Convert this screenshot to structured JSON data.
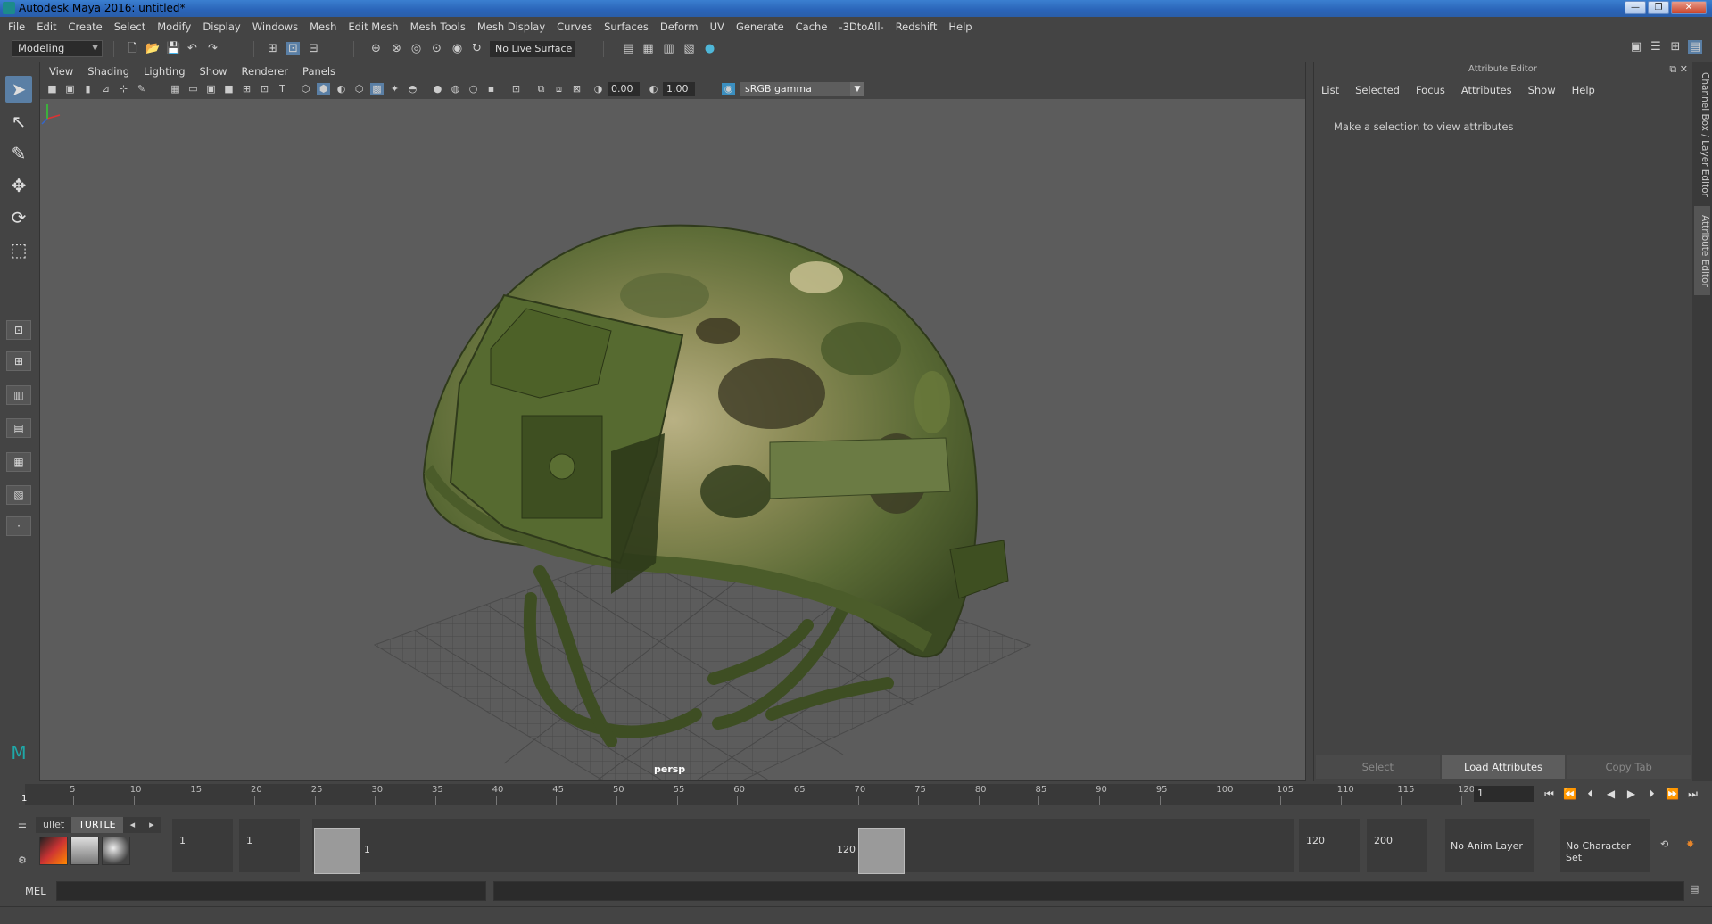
{
  "window": {
    "title": "Autodesk Maya 2016: untitled*",
    "controls": [
      "—",
      "❐",
      "✕"
    ]
  },
  "menubar": [
    "File",
    "Edit",
    "Create",
    "Select",
    "Modify",
    "Display",
    "Windows",
    "Mesh",
    "Edit Mesh",
    "Mesh Tools",
    "Mesh Display",
    "Curves",
    "Surfaces",
    "Deform",
    "UV",
    "Generate",
    "Cache",
    "-3DtoAll-",
    "Redshift",
    "Help"
  ],
  "toolbar": {
    "mode": "Modeling",
    "live_surface": "No Live Surface"
  },
  "panel": {
    "menu": [
      "View",
      "Shading",
      "Lighting",
      "Show",
      "Renderer",
      "Panels"
    ],
    "exposure": "0.00",
    "gamma": "1.00",
    "color_space": "sRGB gamma",
    "camera": "persp"
  },
  "attribute_editor": {
    "title": "Attribute Editor",
    "menu": [
      "List",
      "Selected",
      "Focus",
      "Attributes",
      "Show",
      "Help"
    ],
    "message": "Make a selection to view attributes",
    "buttons": {
      "select": "Select",
      "load": "Load Attributes",
      "copy": "Copy Tab"
    }
  },
  "side_tabs": {
    "channel_box": "Channel Box / Layer Editor",
    "attribute_editor": "Attribute Editor"
  },
  "timeslider": {
    "ticks": [
      "5",
      "10",
      "15",
      "20",
      "25",
      "30",
      "35",
      "40",
      "45",
      "50",
      "55",
      "60",
      "65",
      "70",
      "75",
      "80",
      "85",
      "90",
      "95",
      "100",
      "105",
      "110",
      "115",
      "120"
    ],
    "current_frame": "1",
    "frame_field": "1"
  },
  "range": {
    "shelf_tabs": [
      "ullet",
      "TURTLE"
    ],
    "start": "1",
    "playback_start": "1",
    "slider_start": "1",
    "slider_end": "120",
    "playback_end": "120",
    "end": "200",
    "anim_layer": "No Anim Layer",
    "character_set": "No Character Set"
  },
  "command": {
    "label": "MEL"
  }
}
